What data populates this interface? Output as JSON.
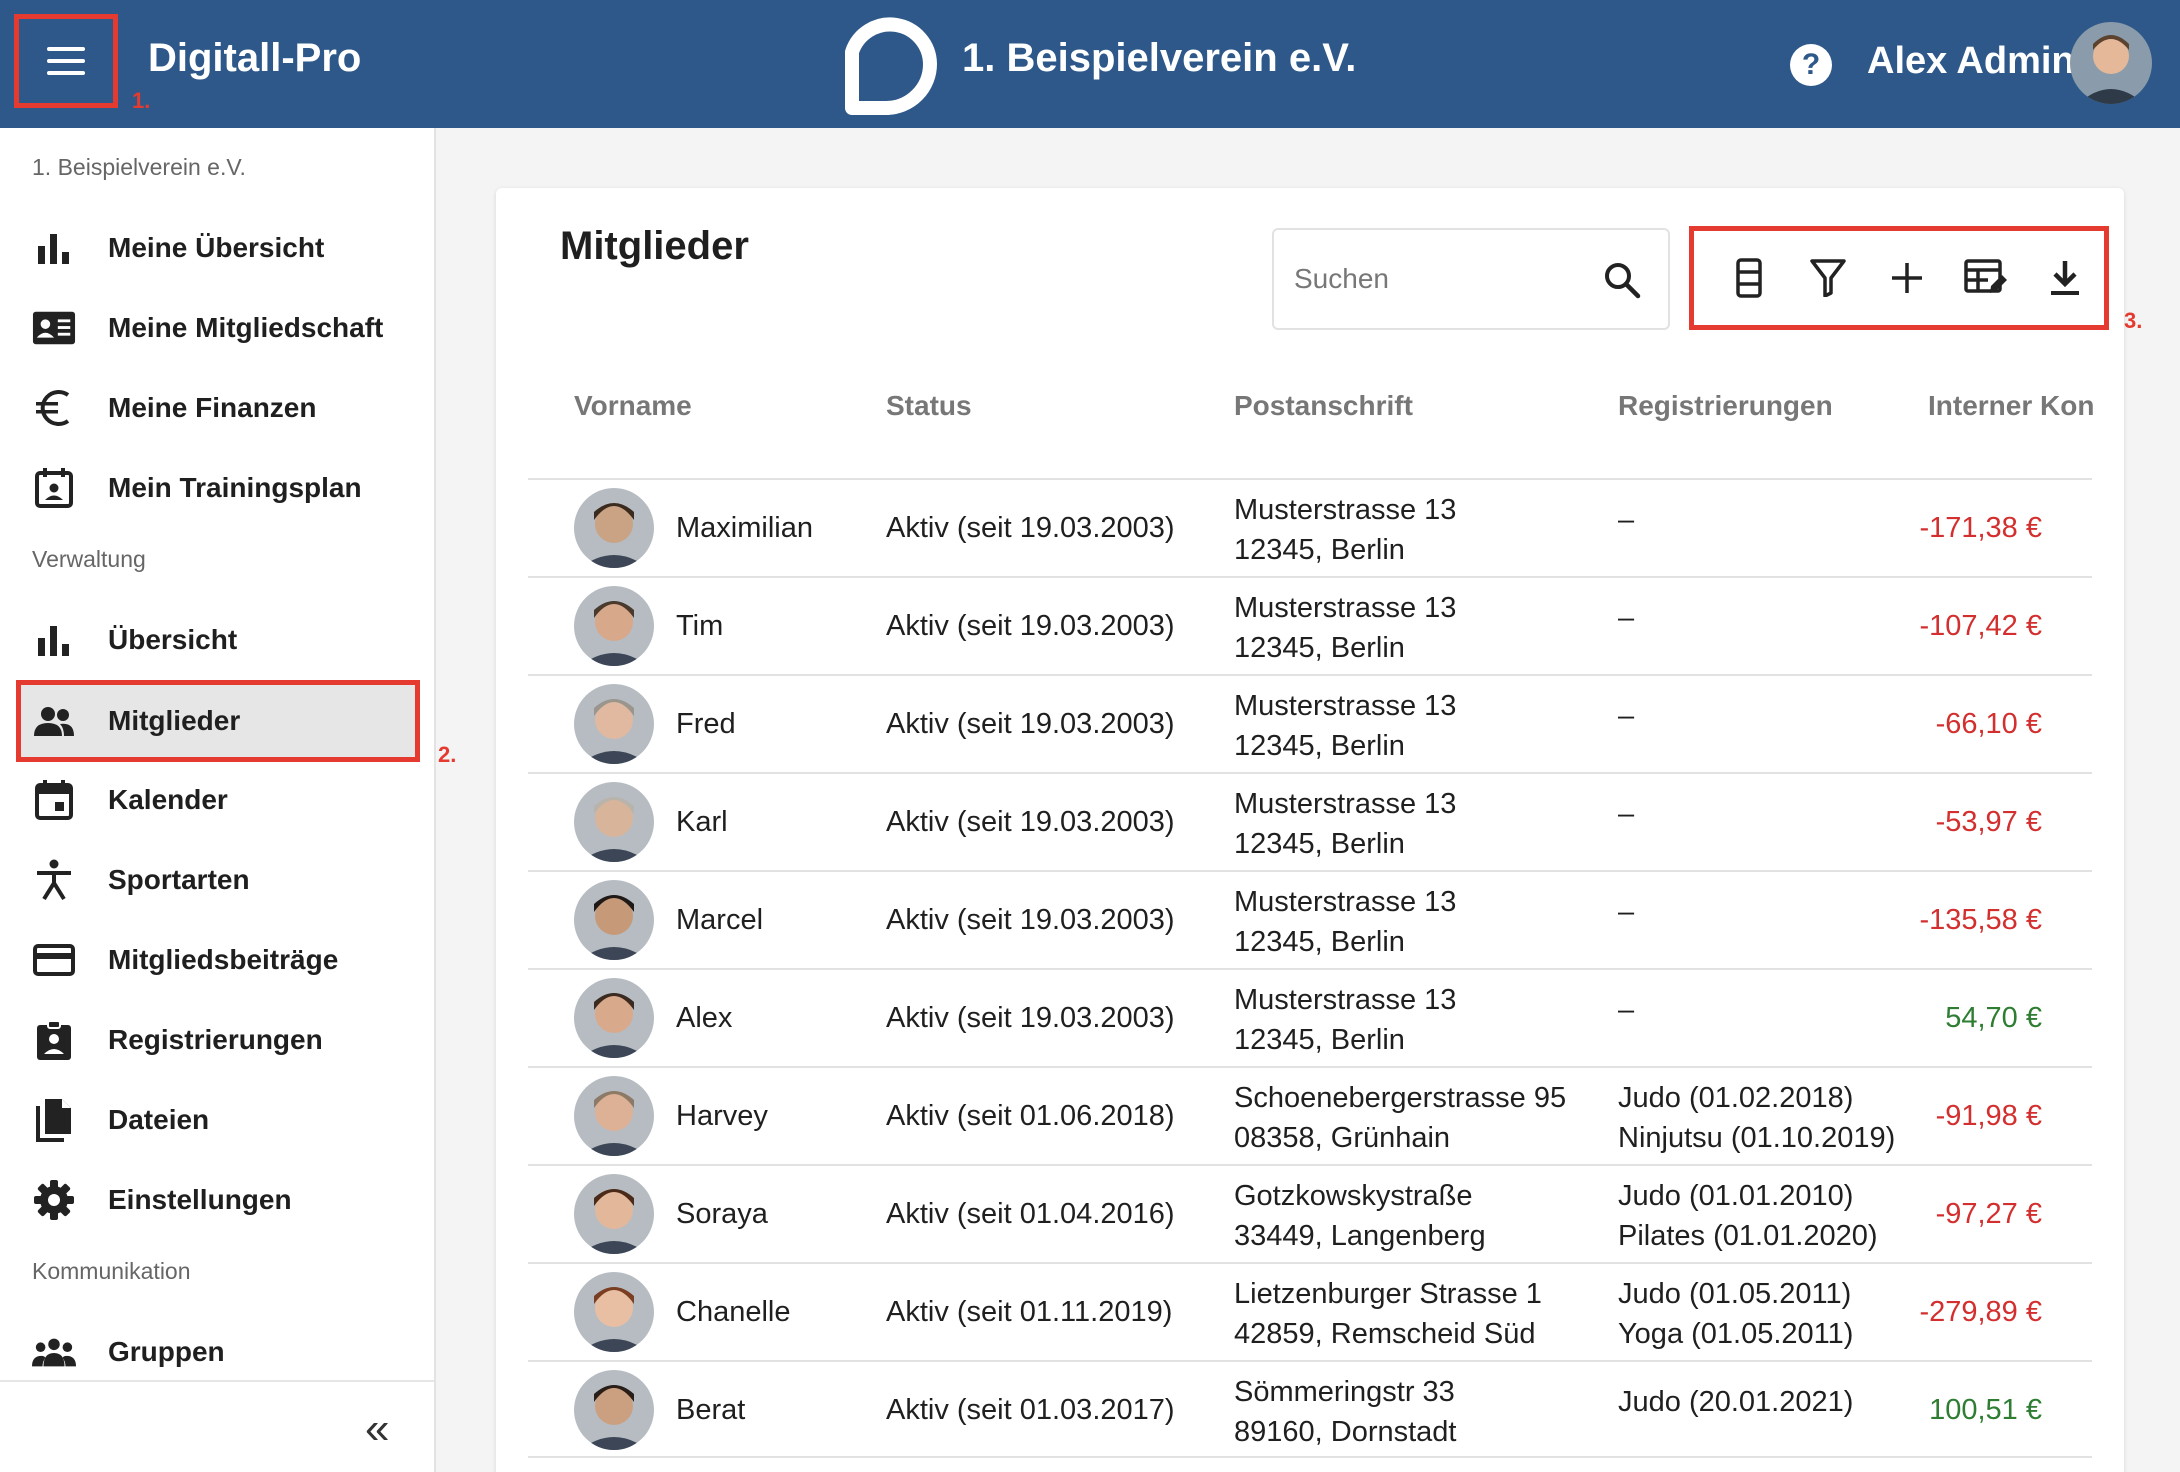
{
  "header": {
    "app_title": "Digitall-Pro",
    "club_title": "1. Beispielverein e.V.",
    "user_name": "Alex Admin",
    "help_label": "?",
    "annotation_1": "1.",
    "annotation_2": "2.",
    "annotation_3": "3."
  },
  "colors": {
    "header_bg": "#2d5889",
    "highlight": "#e53a2f",
    "negative": "#d32f2f",
    "positive": "#2e7d32"
  },
  "sidebar": {
    "club_label": "1. Beispielverein e.V.",
    "section_admin": "Verwaltung",
    "section_comm": "Kommunikation",
    "collapse_label": "«",
    "personal_items": [
      {
        "label": "Meine Übersicht",
        "icon": "bar-chart-icon"
      },
      {
        "label": "Meine Mitgliedschaft",
        "icon": "id-card-icon"
      },
      {
        "label": "Meine Finanzen",
        "icon": "euro-icon"
      },
      {
        "label": "Mein Trainingsplan",
        "icon": "calendar-person-icon"
      }
    ],
    "admin_items": [
      {
        "label": "Übersicht",
        "icon": "bar-chart-icon"
      },
      {
        "label": "Mitglieder",
        "icon": "people-icon",
        "active": true
      },
      {
        "label": "Kalender",
        "icon": "calendar-icon"
      },
      {
        "label": "Sportarten",
        "icon": "sport-figure-icon"
      },
      {
        "label": "Mitgliedsbeiträge",
        "icon": "credit-card-icon"
      },
      {
        "label": "Registrierungen",
        "icon": "clipboard-person-icon"
      },
      {
        "label": "Dateien",
        "icon": "files-icon"
      },
      {
        "label": "Einstellungen",
        "icon": "gear-icon"
      }
    ],
    "comm_items": [
      {
        "label": "Gruppen",
        "icon": "groups-icon"
      }
    ]
  },
  "main": {
    "title": "Mitglieder",
    "search_placeholder": "Suchen",
    "toolbar": [
      "columns-icon",
      "filter-icon",
      "add-icon",
      "edit-table-icon",
      "download-icon"
    ],
    "columns": [
      "Vorname",
      "Status",
      "Postanschrift",
      "Registrierungen",
      "Interner Kon"
    ],
    "rows": [
      {
        "name": "Maximilian",
        "status": "Aktiv (seit 19.03.2003)",
        "addr1": "Musterstrasse 13",
        "addr2": "12345, Berlin",
        "reg1": "–",
        "reg2": "",
        "balance": "-171,38 €",
        "sign": "neg"
      },
      {
        "name": "Tim",
        "status": "Aktiv (seit 19.03.2003)",
        "addr1": "Musterstrasse 13",
        "addr2": "12345, Berlin",
        "reg1": "–",
        "reg2": "",
        "balance": "-107,42 €",
        "sign": "neg"
      },
      {
        "name": "Fred",
        "status": "Aktiv (seit 19.03.2003)",
        "addr1": "Musterstrasse 13",
        "addr2": "12345, Berlin",
        "reg1": "–",
        "reg2": "",
        "balance": "-66,10 €",
        "sign": "neg"
      },
      {
        "name": "Karl",
        "status": "Aktiv (seit 19.03.2003)",
        "addr1": "Musterstrasse 13",
        "addr2": "12345, Berlin",
        "reg1": "–",
        "reg2": "",
        "balance": "-53,97 €",
        "sign": "neg"
      },
      {
        "name": "Marcel",
        "status": "Aktiv (seit 19.03.2003)",
        "addr1": "Musterstrasse 13",
        "addr2": "12345, Berlin",
        "reg1": "–",
        "reg2": "",
        "balance": "-135,58 €",
        "sign": "neg"
      },
      {
        "name": "Alex",
        "status": "Aktiv (seit 19.03.2003)",
        "addr1": "Musterstrasse 13",
        "addr2": "12345, Berlin",
        "reg1": "–",
        "reg2": "",
        "balance": "54,70 €",
        "sign": "pos"
      },
      {
        "name": "Harvey",
        "status": "Aktiv (seit 01.06.2018)",
        "addr1": "Schoenebergerstrasse 95",
        "addr2": "08358, Grünhain",
        "reg1": "Judo (01.02.2018)",
        "reg2": "Ninjutsu (01.10.2019)",
        "balance": "-91,98 €",
        "sign": "neg"
      },
      {
        "name": "Soraya",
        "status": "Aktiv (seit 01.04.2016)",
        "addr1": "Gotzkowskystraße",
        "addr2": "33449, Langenberg",
        "reg1": "Judo (01.01.2010)",
        "reg2": "Pilates (01.01.2020)",
        "balance": "-97,27 €",
        "sign": "neg"
      },
      {
        "name": "Chanelle",
        "status": "Aktiv (seit 01.11.2019)",
        "addr1": "Lietzenburger Strasse 1",
        "addr2": "42859, Remscheid Süd",
        "reg1": "Judo (01.05.2011)",
        "reg2": "Yoga (01.05.2011)",
        "balance": "-279,89 €",
        "sign": "neg"
      },
      {
        "name": "Berat",
        "status": "Aktiv (seit 01.03.2017)",
        "addr1": "Sömmeringstr 33",
        "addr2": "89160, Dornstadt",
        "reg1": "Judo (20.01.2021)",
        "reg2": "",
        "balance": "100,51 €",
        "sign": "pos"
      }
    ]
  }
}
